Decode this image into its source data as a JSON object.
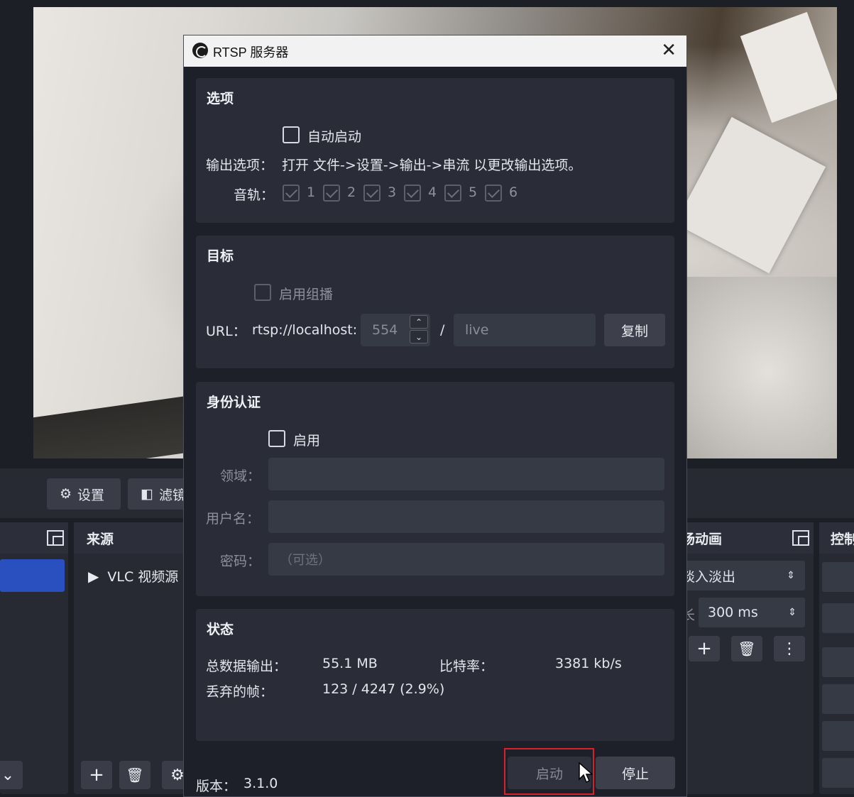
{
  "obs": {
    "settings_label": "设置",
    "filters_label": "滤镜",
    "sources_title": "来源",
    "source_item": "VLC 视频源",
    "transitions_title": "场动画",
    "transition_value": "淡入淡出",
    "duration_label": "长",
    "duration_value": "300 ms",
    "controls_title": "控制"
  },
  "dialog": {
    "title": "RTSP 服务器",
    "options": {
      "title": "选项",
      "autostart_label": "自动启动",
      "output_label": "输出选项：",
      "output_hint": "打开 文件->设置->输出->串流 以更改输出选项。",
      "tracks_label": "音轨：",
      "tracks": [
        "1",
        "2",
        "3",
        "4",
        "5",
        "6"
      ]
    },
    "target": {
      "title": "目标",
      "multicast_label": "启用组播",
      "url_label": "URL：",
      "url_prefix": "rtsp://localhost:",
      "port": "554",
      "slash": "/",
      "path": "live",
      "copy_label": "复制"
    },
    "auth": {
      "title": "身份认证",
      "enable_label": "启用",
      "realm_label": "领域：",
      "username_label": "用户名：",
      "password_label": "密码：",
      "password_placeholder": "（可选）"
    },
    "status": {
      "title": "状态",
      "total_output_label": "总数据输出：",
      "total_output_value": "55.1 MB",
      "bitrate_label": "比特率：",
      "bitrate_value": "3381 kb/s",
      "dropped_label": "丢弃的帧：",
      "dropped_value": "123 / 4247 (2.9%)"
    },
    "version_label": "版本：",
    "version_value": "3.1.0",
    "start_label": "启动",
    "stop_label": "停止"
  }
}
